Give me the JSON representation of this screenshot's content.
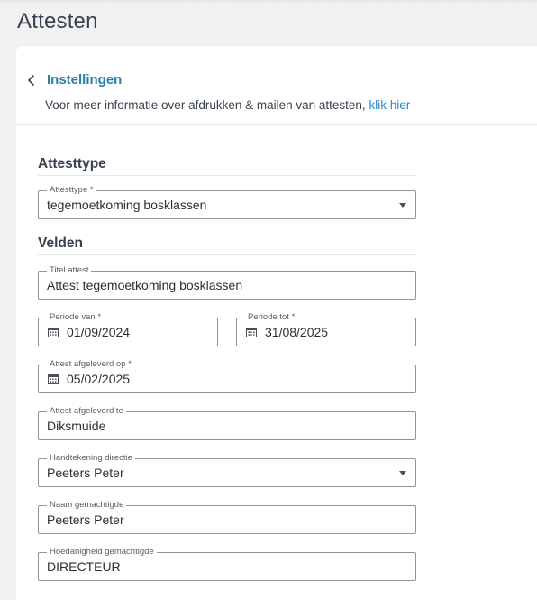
{
  "page": {
    "title": "Attesten"
  },
  "header": {
    "title": "Instellingen",
    "info_text": "Voor meer informatie over afdrukken & mailen van attesten,",
    "info_link": "klik hier"
  },
  "sections": {
    "attesttype": "Attesttype",
    "velden": "Velden"
  },
  "fields": {
    "attesttype": {
      "label": "Attesttype *",
      "value": "tegemoetkoming bosklassen"
    },
    "titel_attest": {
      "label": "Titel attest",
      "value": "Attest tegemoetkoming bosklassen"
    },
    "periode_van": {
      "label": "Periode van *",
      "value": "01/09/2024"
    },
    "periode_tot": {
      "label": "Periode tot *",
      "value": "31/08/2025"
    },
    "afgeleverd_op": {
      "label": "Attest afgeleverd op *",
      "value": "05/02/2025"
    },
    "afgeleverd_te": {
      "label": "Attest afgeleverd te",
      "value": "Diksmuide"
    },
    "handtekening": {
      "label": "Handtekening directie",
      "value": "Peeters Peter"
    },
    "naam_gemachtigde": {
      "label": "Naam gemachtigde",
      "value": "Peeters Peter"
    },
    "hoedanigheid": {
      "label": "Hoedanigheid gemachtigde",
      "value": "DIRECTEUR"
    }
  },
  "icons": {
    "back": "chevron-left-icon",
    "calendar": "calendar-icon",
    "dropdown": "caret-down-icon"
  },
  "colors": {
    "accent": "#2a7fa8",
    "link": "#2a86c4",
    "field_border": "#8f959c"
  }
}
